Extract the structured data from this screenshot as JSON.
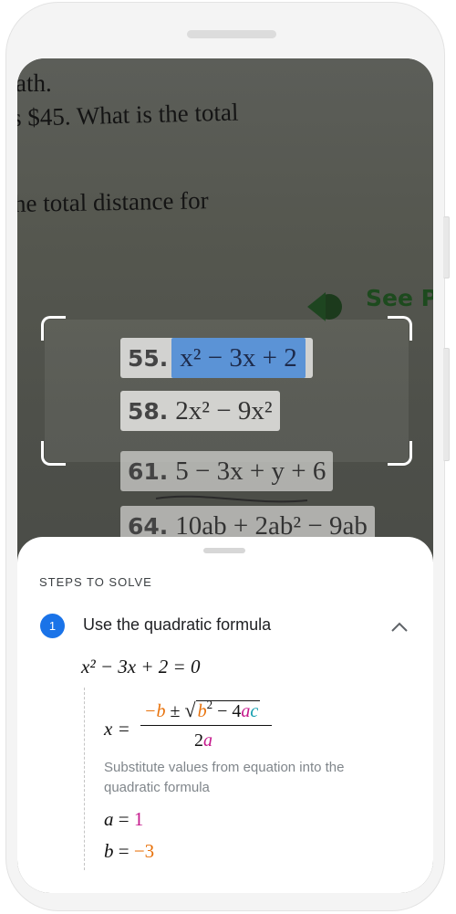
{
  "camera": {
    "book_lines": [
      "ath.",
      "s $45. What is the total",
      "he total distance for"
    ],
    "see_label": "See P",
    "problems": [
      {
        "number": "55.",
        "expression": "x² − 3x + 2",
        "selected": true
      },
      {
        "number": "58.",
        "expression": "2x² − 9x²",
        "selected": false
      },
      {
        "number": "61.",
        "expression": "5 − 3x + y + 6",
        "selected": false
      },
      {
        "number": "64.",
        "expression": "10ab + 2ab² − 9ab",
        "selected": false
      }
    ]
  },
  "sheet": {
    "title": "STEPS TO SOLVE",
    "step": {
      "number": "1",
      "title": "Use the quadratic formula",
      "equation": "x² − 3x + 2 = 0",
      "formula": {
        "lhs": "x =",
        "numerator_b": "−b",
        "pm": "±",
        "radicand": "b² − 4ac",
        "denominator": "2a"
      },
      "description": "Substitute values from equation into the quadratic formula",
      "substitutions": [
        {
          "var": "a",
          "eq": "=",
          "value": "1"
        },
        {
          "var": "b",
          "eq": "=",
          "value": "−3"
        }
      ]
    }
  },
  "colors": {
    "accent": "#1a73e8",
    "b_coefficient": "#e8710a",
    "a_coefficient": "#c5198c",
    "c_coefficient": "#129eaf",
    "selection_highlight": "#5b93d6"
  },
  "icons": {
    "collapse": "chevron-up-icon",
    "book_arrow": "green-arrow-icon"
  }
}
